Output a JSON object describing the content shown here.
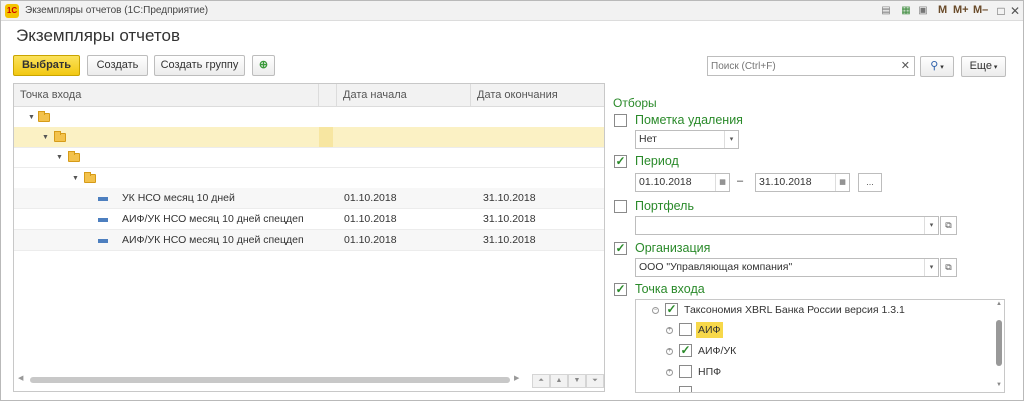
{
  "window": {
    "title": "Экземпляры отчетов  (1С:Предприятие)",
    "logo_text": "1С"
  },
  "titlebar_tools": {
    "m": "M",
    "mplus": "M+",
    "mminus": "M–"
  },
  "page": {
    "title": "Экземпляры отчетов"
  },
  "toolbar": {
    "select_label": "Выбрать",
    "create_label": "Создать",
    "create_group_label": "Создать группу",
    "search_placeholder": "Поиск (Ctrl+F)",
    "more_label": "Еще"
  },
  "grid": {
    "columns": [
      "Точка входа",
      "Дата начала",
      "Дата окончания"
    ],
    "rows": [
      {
        "name": "УК НСО месяц 10 дней",
        "start": "01.10.2018",
        "end": "31.10.2018"
      },
      {
        "name": "АИФ/УК НСО месяц 10 дней спецдеп",
        "start": "01.10.2018",
        "end": "31.10.2018"
      },
      {
        "name": "АИФ/УК НСО месяц 10 дней спецдеп",
        "start": "01.10.2018",
        "end": "31.10.2018"
      }
    ]
  },
  "filters": {
    "title": "Отборы",
    "deletion_mark": {
      "label": "Пометка удаления",
      "value": "Нет",
      "checked": false
    },
    "period": {
      "label": "Период",
      "from": "01.10.2018",
      "separator": "–",
      "to": "31.10.2018",
      "more": "...",
      "checked": true
    },
    "portfolio": {
      "label": "Портфель",
      "value": "",
      "checked": false
    },
    "organization": {
      "label": "Организация",
      "value": "ООО \"Управляющая  компания\"",
      "checked": true
    },
    "entry_point": {
      "label": "Точка входа",
      "checked": true,
      "tree": [
        {
          "label": "Таксономия XBRL Банка России версия 1.3.1",
          "checked": true,
          "level": 0
        },
        {
          "label": "АИФ",
          "checked": false,
          "level": 1,
          "highlight": true
        },
        {
          "label": "АИФ/УК",
          "checked": true,
          "level": 1
        },
        {
          "label": "НПФ",
          "checked": false,
          "level": 1
        }
      ]
    }
  },
  "colors": {
    "accent_yellow": "#f2c812",
    "filter_green": "#2a8a2a",
    "selected_row": "#fbf1c4"
  }
}
